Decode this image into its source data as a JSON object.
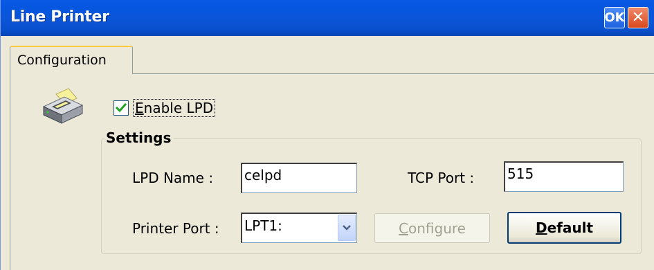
{
  "window": {
    "title": "Line Printer",
    "ok_label": "OK",
    "close_glyph": "✕"
  },
  "tabs": [
    {
      "label": "Configuration",
      "selected": true
    }
  ],
  "icons": {
    "printer": "printer-icon",
    "checkmark": "checkmark-icon",
    "dropdown": "chevron-down-icon"
  },
  "enable_lpd": {
    "label_first": "E",
    "label_rest": "nable LPD",
    "checked": true
  },
  "settings": {
    "title": "Settings",
    "lpd_name_label": "LPD Name :",
    "lpd_name_value": "celpd",
    "tcp_port_label": "TCP Port :",
    "tcp_port_value": "515",
    "printer_port_label": "Printer Port :",
    "printer_port_value": "LPT1:",
    "configure_first": "C",
    "configure_rest": "onfigure",
    "configure_enabled": false,
    "default_first": "D",
    "default_rest": "efault"
  },
  "colors": {
    "titlebar": "#0a5ae6",
    "dialog_bg": "#ece9d8",
    "checkmark": "#21a121",
    "tab_highlight": "#ffc83c"
  }
}
